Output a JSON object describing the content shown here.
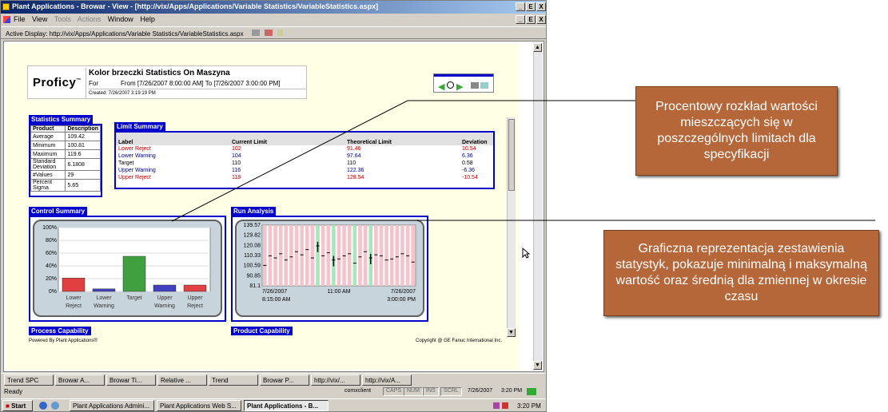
{
  "window": {
    "title": "Plant Applications - Browar - View - [http://vix/Apps/Applications/Variable Statistics/VariableStatistics.aspx]",
    "min": "_",
    "max": "Е",
    "close": "X"
  },
  "menu": {
    "file": "File",
    "view": "View",
    "tools": "Tools",
    "actions": "Actions",
    "window": "Window",
    "help": "Help"
  },
  "address": {
    "label": "Active Display: http://vix/Apps/Applications/Variable Statistics/VariableStatistics.aspx"
  },
  "header": {
    "logo": "Proficy",
    "tm": "™",
    "title": "Kolor brzeczki Statistics On Maszyna",
    "for_label": "For",
    "range": "From [7/26/2007 8:00:00 AM] To [7/26/2007 3:00:00 PM]",
    "created": "Created: 7/26/2007 3:19:19 PM"
  },
  "stats": {
    "heading": "Statistics Summary",
    "col1": "Product",
    "col2": "Description",
    "rows": [
      {
        "k": "Average",
        "v": "109.42"
      },
      {
        "k": "Minimum",
        "v": "100.81"
      },
      {
        "k": "Maximum",
        "v": "119.6"
      },
      {
        "k": "Standard Deviation",
        "v": "6.1808"
      },
      {
        "k": "#Values",
        "v": "29"
      },
      {
        "k": "Percent Sigma",
        "v": "5.65"
      }
    ]
  },
  "limits": {
    "heading": "Limit Summary",
    "h_label": "Label",
    "h_current": "Current Limit",
    "h_theor": "Theoretical Limit",
    "h_dev": "Deviation",
    "rows": [
      {
        "label": "Lower Reject",
        "cur": "102",
        "theo": "91.46",
        "dev": "10.54"
      },
      {
        "label": "Lower Warning",
        "cur": "104",
        "theo": "97.64",
        "dev": "6.36"
      },
      {
        "label": "Target",
        "cur": "110",
        "theo": "110",
        "dev": "0.58"
      },
      {
        "label": "Upper Warning",
        "cur": "116",
        "theo": "122.36",
        "dev": "-6.36"
      },
      {
        "label": "Upper Reject",
        "cur": "118",
        "theo": "128.54",
        "dev": "-10.54"
      }
    ]
  },
  "control": {
    "heading": "Control Summary"
  },
  "run": {
    "heading": "Run Analysis",
    "x_start_date": "7/26/2007",
    "x_start_time": "8:15:00 AM",
    "x_mid": "11:00 AM",
    "x_end_date": "7/26/2007",
    "x_end_time": "3:00:00 PM"
  },
  "process": {
    "heading": "Process Capability"
  },
  "product": {
    "heading": "Product Capability"
  },
  "footer": {
    "powered": "Powered By Plant Applications®",
    "copyright": "Copyright @ GE Fanuc International Inc."
  },
  "callouts": {
    "top": "Procentowy rozkład wartości mieszczących się w poszczególnych limitach dla specyfikacji",
    "bottom": "Graficzna reprezentacja zestawienia statystyk, pokazuje minimalną i maksymalną wartość oraz średnią dla zmiennej w okresie czasu"
  },
  "appbar": [
    "Trend SPC",
    "Browar A...",
    "Browar Ti...",
    "Relative ...",
    "Trend",
    "Browar P...",
    "http://vix/...",
    "http://vix/A..."
  ],
  "status": {
    "ready": "Ready",
    "user": "comxclient",
    "caps": "CAPS",
    "num": "NUM",
    "ins": "INS",
    "scrl": "SCRL",
    "date": "7/26/2007",
    "time": "3:20 PM"
  },
  "taskbar": {
    "start": "Start",
    "items": [
      "Plant Applications Admini...",
      "Plant Applications Web S...",
      "Plant Applications - B..."
    ],
    "clock": "3:20 PM"
  },
  "chart_data": [
    {
      "type": "bar",
      "title": "",
      "categories": [
        "Lower Reject",
        "Lower Warning",
        "Target",
        "Upper Warning",
        "Upper Reject"
      ],
      "values": [
        21,
        4,
        55,
        10,
        10
      ],
      "ylim": [
        0,
        100
      ],
      "yticks": [
        "0%",
        "20%",
        "40%",
        "60%",
        "80%",
        "100%"
      ],
      "colors": [
        "#e04040",
        "#4040c0",
        "#40a040",
        "#4040c0",
        "#e04040"
      ]
    },
    {
      "type": "scatter",
      "title": "",
      "yticks": [
        "81.1",
        "90.85",
        "100.59",
        "110.33",
        "120.08",
        "129.82",
        "139.57"
      ],
      "ylim": [
        81.1,
        139.57
      ],
      "y": [
        100.8,
        110,
        108,
        112,
        106,
        109,
        114,
        111,
        116,
        108,
        119.6,
        110,
        113,
        106,
        107,
        110,
        112,
        103,
        109,
        114,
        108,
        111,
        110,
        106,
        107,
        109,
        112,
        110,
        104
      ]
    }
  ]
}
